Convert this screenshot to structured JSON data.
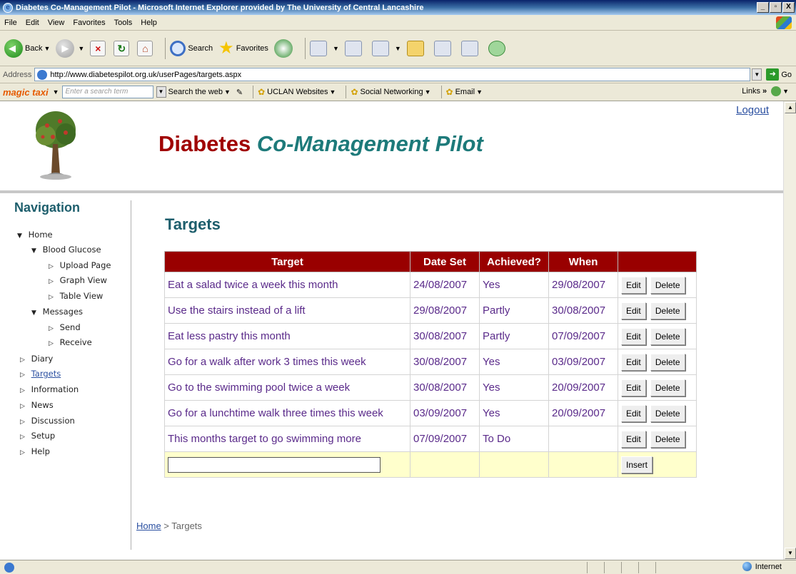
{
  "window": {
    "title": "Diabetes Co-Management Pilot - Microsoft Internet Explorer provided by The University of Central Lancashire",
    "controls": [
      "_",
      "▫",
      "X"
    ]
  },
  "menu": [
    "File",
    "Edit",
    "View",
    "Favorites",
    "Tools",
    "Help"
  ],
  "toolbar": {
    "back_label": "Back",
    "search_label": "Search",
    "favorites_label": "Favorites"
  },
  "address": {
    "label": "Address",
    "url": "http://www.diabetespilot.org.uk/userPages/targets.aspx",
    "go_label": "Go"
  },
  "linksbar": {
    "logo": "magic taxi",
    "search_placeholder": "Enter a search term",
    "search_web_label": "Search the web",
    "uclan_label": "UCLAN Websites",
    "social_label": "Social Networking",
    "email_label": "Email",
    "links_label": "Links"
  },
  "site": {
    "title_part1": "Diabetes",
    "title_part2": "Co-Management Pilot",
    "logout": "Logout"
  },
  "nav": {
    "title": "Navigation",
    "items": [
      {
        "label": "Home",
        "arrow": "▼",
        "level": 0
      },
      {
        "label": "Blood Glucose",
        "arrow": "▼",
        "level": 1
      },
      {
        "label": "Upload Page",
        "arrow": "▷",
        "level": 2
      },
      {
        "label": "Graph View",
        "arrow": "▷",
        "level": 2
      },
      {
        "label": "Table View",
        "arrow": "▷",
        "level": 2
      },
      {
        "label": "Messages",
        "arrow": "▼",
        "level": 1
      },
      {
        "label": "Send",
        "arrow": "▷",
        "level": 2
      },
      {
        "label": "Receive",
        "arrow": "▷",
        "level": 2
      },
      {
        "label": "Diary",
        "arrow": "▷",
        "level": 0
      },
      {
        "label": "Targets",
        "arrow": "▷",
        "level": 0,
        "active": true
      },
      {
        "label": "Information",
        "arrow": "▷",
        "level": 0
      },
      {
        "label": "News",
        "arrow": "▷",
        "level": 0
      },
      {
        "label": "Discussion",
        "arrow": "▷",
        "level": 0
      },
      {
        "label": "Setup",
        "arrow": "▷",
        "level": 0
      },
      {
        "label": "Help",
        "arrow": "▷",
        "level": 0
      }
    ]
  },
  "main": {
    "heading": "Targets",
    "columns": [
      "Target",
      "Date Set",
      "Achieved?",
      "When",
      ""
    ],
    "rows": [
      {
        "target": "Eat a salad twice a week this month",
        "date_set": "24/08/2007",
        "achieved": "Yes",
        "when": "29/08/2007"
      },
      {
        "target": "Use the stairs instead of a lift",
        "date_set": "29/08/2007",
        "achieved": "Partly",
        "when": "30/08/2007"
      },
      {
        "target": "Eat less pastry this month",
        "date_set": "30/08/2007",
        "achieved": "Partly",
        "when": "07/09/2007"
      },
      {
        "target": "Go for a walk after work 3 times this week",
        "date_set": "30/08/2007",
        "achieved": "Yes",
        "when": "03/09/2007"
      },
      {
        "target": "Go to the swimming pool twice a week",
        "date_set": "30/08/2007",
        "achieved": "Yes",
        "when": "20/09/2007"
      },
      {
        "target": "Go for a lunchtime walk three times this week",
        "date_set": "03/09/2007",
        "achieved": "Yes",
        "when": "20/09/2007"
      },
      {
        "target": "This months target to go swimming more",
        "date_set": "07/09/2007",
        "achieved": "To Do",
        "when": ""
      }
    ],
    "edit_label": "Edit",
    "delete_label": "Delete",
    "insert_label": "Insert",
    "new_target_value": ""
  },
  "breadcrumb": {
    "home": "Home",
    "separator": " > ",
    "current": "Targets"
  },
  "status": {
    "zone": "Internet"
  },
  "colors": {
    "header_red": "#990000",
    "title_teal": "#1d7a7a",
    "link_purple": "#5a2a8a"
  }
}
